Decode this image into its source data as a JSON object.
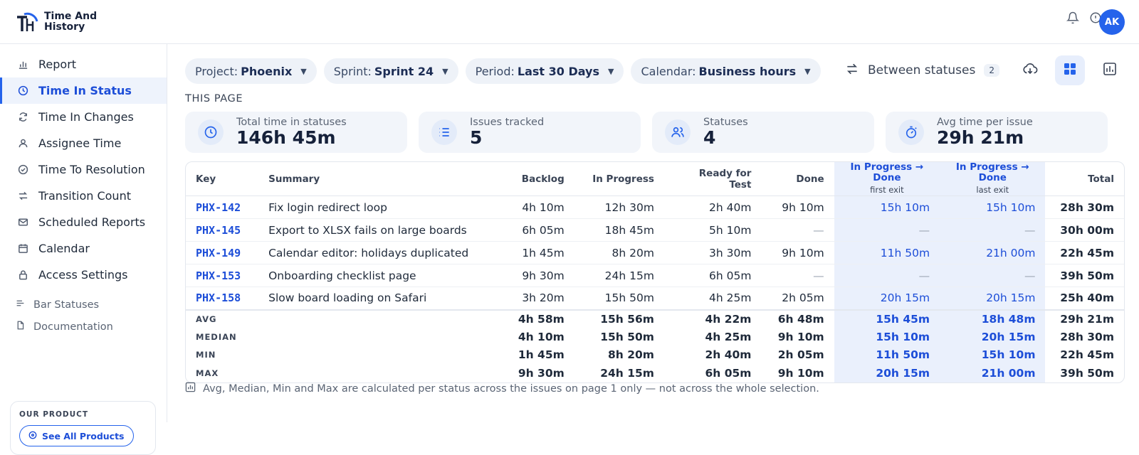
{
  "app": {
    "logo_line1": "Time And",
    "logo_line2": "History",
    "logo_mark": "TH",
    "avatar_initials": "AK"
  },
  "sidebar": {
    "items": [
      {
        "label": "Report",
        "icon": "bar-chart-icon"
      },
      {
        "label": "Time In Status",
        "icon": "clock-icon",
        "active": true
      },
      {
        "label": "Time In Changes",
        "icon": "refresh-icon"
      },
      {
        "label": "Assignee Time",
        "icon": "user-icon"
      },
      {
        "label": "Time To Resolution",
        "icon": "check-circle-icon"
      },
      {
        "label": "Transition Count",
        "icon": "transition-icon"
      },
      {
        "label": "Scheduled Reports",
        "icon": "mail-icon"
      },
      {
        "label": "Calendar",
        "icon": "calendar-icon"
      },
      {
        "label": "Access Settings",
        "icon": "lock-icon"
      }
    ],
    "sub_items": [
      {
        "label": "Bar Statuses",
        "icon": "bars-icon"
      },
      {
        "label": "Documentation",
        "icon": "document-icon"
      }
    ],
    "product_label": "OUR PRODUCT",
    "see_all_label": "See All Products"
  },
  "filters": [
    {
      "name": "Project:",
      "value": "Phoenix"
    },
    {
      "name": "Sprint:",
      "value": "Sprint 24"
    },
    {
      "name": "Period:",
      "value": "Last 30 Days"
    },
    {
      "name": "Calendar:",
      "value": "Business hours"
    }
  ],
  "toolbar": {
    "between_label": "Between statuses",
    "between_count": "2"
  },
  "section_label": "THIS PAGE",
  "stats": [
    {
      "label": "Total time in statuses",
      "value": "146h 45m",
      "icon": "clock-icon"
    },
    {
      "label": "Issues tracked",
      "value": "5",
      "icon": "list-icon"
    },
    {
      "label": "Statuses",
      "value": "4",
      "icon": "users-icon"
    },
    {
      "label": "Avg time per issue",
      "value": "29h 21m",
      "icon": "stopwatch-icon"
    }
  ],
  "table": {
    "headers": {
      "key": "Key",
      "summary": "Summary",
      "backlog": "Backlog",
      "in_progress": "In Progress",
      "ready": "Ready for Test",
      "done": "Done",
      "between1": "In Progress → Done",
      "between1_sub": "first exit",
      "between2": "In Progress → Done",
      "between2_sub": "last exit",
      "total": "Total"
    },
    "rows": [
      {
        "key": "PHX-142",
        "summary": "Fix login redirect loop",
        "backlog": "4h 10m",
        "in_progress": "12h 30m",
        "ready": "2h 40m",
        "done": "9h 10m",
        "between1": "15h 10m",
        "between2": "15h 10m",
        "total": "28h 30m"
      },
      {
        "key": "PHX-145",
        "summary": "Export to XLSX fails on large boards",
        "backlog": "6h 05m",
        "in_progress": "18h 45m",
        "ready": "5h 10m",
        "done": "—",
        "between1": "—",
        "between2": "—",
        "total": "30h 00m"
      },
      {
        "key": "PHX-149",
        "summary": "Calendar editor: holidays duplicated",
        "backlog": "1h 45m",
        "in_progress": "8h 20m",
        "ready": "3h 30m",
        "done": "9h 10m",
        "between1": "11h 50m",
        "between2": "21h 00m",
        "total": "22h 45m"
      },
      {
        "key": "PHX-153",
        "summary": "Onboarding checklist page",
        "backlog": "9h 30m",
        "in_progress": "24h 15m",
        "ready": "6h 05m",
        "done": "—",
        "between1": "—",
        "between2": "—",
        "total": "39h 50m"
      },
      {
        "key": "PHX-158",
        "summary": "Slow board loading on Safari",
        "backlog": "3h 20m",
        "in_progress": "15h 50m",
        "ready": "4h 25m",
        "done": "2h 05m",
        "between1": "20h 15m",
        "between2": "20h 15m",
        "total": "25h 40m"
      }
    ],
    "aggregates": [
      {
        "label": "AVG",
        "backlog": "4h 58m",
        "in_progress": "15h 56m",
        "ready": "4h 22m",
        "done": "6h 48m",
        "between1": "15h 45m",
        "between2": "18h 48m",
        "total": "29h 21m"
      },
      {
        "label": "MEDIAN",
        "backlog": "4h 10m",
        "in_progress": "15h 50m",
        "ready": "4h 25m",
        "done": "9h 10m",
        "between1": "15h 10m",
        "between2": "20h 15m",
        "total": "28h 30m"
      },
      {
        "label": "MIN",
        "backlog": "1h 45m",
        "in_progress": "8h 20m",
        "ready": "2h 40m",
        "done": "2h 05m",
        "between1": "11h 50m",
        "between2": "15h 10m",
        "total": "22h 45m"
      },
      {
        "label": "MAX",
        "backlog": "9h 30m",
        "in_progress": "24h 15m",
        "ready": "6h 05m",
        "done": "9h 10m",
        "between1": "20h 15m",
        "between2": "21h 00m",
        "total": "39h 50m"
      }
    ]
  },
  "footnote": "Avg, Median, Min and Max are calculated per status across the issues on page 1 only — not across the whole selection.",
  "colors": {
    "accent": "#2563eb",
    "highlight": "#eaf0fc"
  }
}
